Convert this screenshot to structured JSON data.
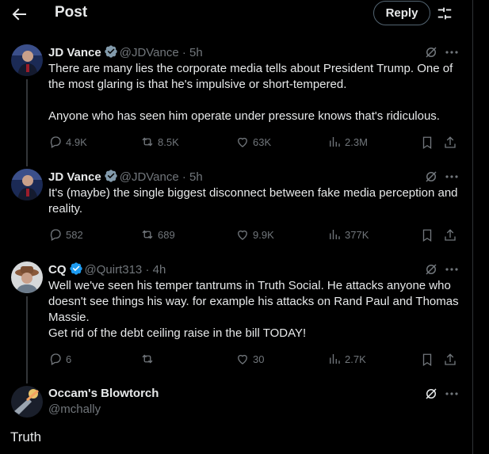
{
  "header": {
    "title": "Post",
    "reply_button": "Reply"
  },
  "icons": {
    "back": "arrow-left-icon",
    "settings": "sliders-icon",
    "reply": "speech-bubble-icon",
    "repost": "repost-icon",
    "like": "heart-icon",
    "views": "bar-chart-icon",
    "bookmark": "bookmark-icon",
    "share": "share-icon",
    "grok": "grok-icon",
    "more": "ellipsis-icon"
  },
  "colors": {
    "verified": "#1d9bf0",
    "muted": "#71767b",
    "text": "#e7e9ea",
    "background": "#000000"
  },
  "tweets": [
    {
      "name": "JD Vance",
      "handle": "@JDVance",
      "dot": "·",
      "time": "5h",
      "text": [
        "There are many lies the corporate media tells about President Trump. One of the most glaring is that he's impulsive or short-tempered.",
        "",
        "Anyone who has seen him operate under pressure knows that's ridiculous."
      ],
      "replies": "4.9K",
      "reposts": "8.5K",
      "likes": "63K",
      "views": "2.3M"
    },
    {
      "name": "JD Vance",
      "handle": "@JDVance",
      "dot": "·",
      "time": "5h",
      "text": [
        "It's (maybe) the single biggest disconnect between fake media perception and reality."
      ],
      "replies": "582",
      "reposts": "689",
      "likes": "9.9K",
      "views": "377K"
    },
    {
      "name": "CQ",
      "handle": "@Quirt313",
      "dot": "·",
      "time": "4h",
      "text": [
        "Well we've seen his temper tantrums in Truth Social. He attacks anyone who doesn't see things his way. for example his attacks on Rand Paul and Thomas Massie.",
        "Get rid of the debt ceiling raise in the bill TODAY!"
      ],
      "replies": "6",
      "reposts": "",
      "likes": "30",
      "views": "2.7K"
    }
  ],
  "main_post": {
    "name": "Occam's Blowtorch",
    "handle": "@mchally",
    "text": "Truth"
  }
}
